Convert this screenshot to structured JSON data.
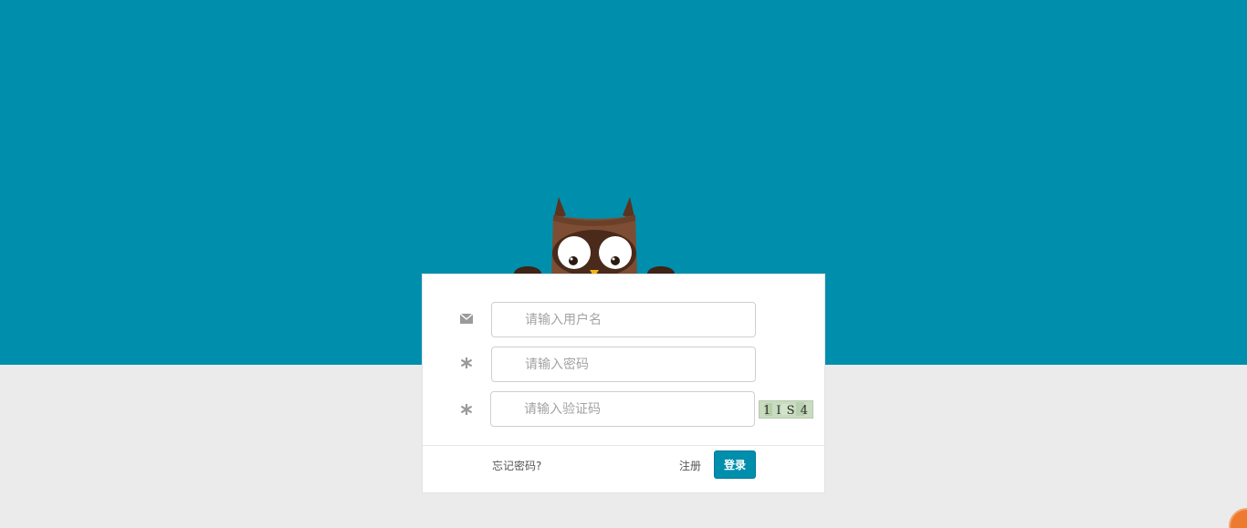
{
  "page": {
    "bg_top": "#008ead",
    "bg_bottom": "#ebebeb",
    "accent": "#008ead"
  },
  "mascot": {
    "name": "owl-mascot"
  },
  "form": {
    "username": {
      "placeholder": "请输入用户名",
      "icon": "envelope-icon"
    },
    "password": {
      "placeholder": "请输入密码",
      "icon": "asterisk-icon"
    },
    "captcha": {
      "placeholder": "请输入验证码",
      "icon": "asterisk-icon",
      "image_text": "1 I S 4"
    }
  },
  "footer": {
    "forgot_label": "忘记密码?",
    "register_label": "注册",
    "login_label": "登录"
  }
}
